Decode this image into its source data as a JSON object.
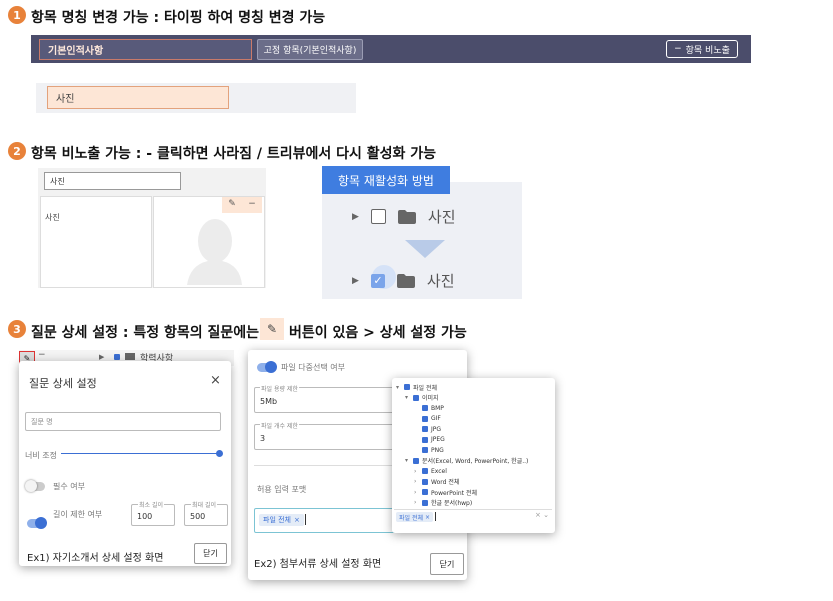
{
  "section1": {
    "badge": "1",
    "heading": "항목 명칭 변경 가능 : 타이핑 하여 명칭 변경 가능",
    "field_value": "기본인적사항",
    "fixed_button": "고정 항목(기본인적사항)",
    "hide_button": "항목 비노출",
    "photo_field": "사진"
  },
  "section2": {
    "badge": "2",
    "heading": "항목 비노출 가능 : - 클릭하면 사라짐 / 트리뷰에서 다시 활성화 가능",
    "search_value": "사진",
    "list_item": "사진",
    "edit_icon": "✎",
    "minus_icon": "−",
    "reactivate_title": "항목 재활성화 방법",
    "tree_item_before": "사진",
    "tree_item_after": "사진"
  },
  "section3": {
    "badge": "3",
    "heading_a": "질문 상세 설정 : 특정 항목의 질문에는",
    "heading_b": "버튼이 있음 > 상세 설정 가능",
    "pencil_icon": "✎",
    "dialog1": {
      "tree_label": "학력사항",
      "title": "질문 상세 설정",
      "close": "×",
      "question_placeholder": "질문 명",
      "width_label": "너비 조정",
      "required_label": "필수 여부",
      "length_label": "길이 제한 여부",
      "min_label": "최소 길이",
      "min_value": "100",
      "max_label": "최대 길이",
      "max_value": "500",
      "caption": "Ex1) 자기소개서 상세 설정 화면",
      "close_button": "닫기"
    },
    "dialog2": {
      "multi_label": "파일 다중선택 여부",
      "capacity_label": "파일 용량 제한",
      "capacity_value": "5Mb",
      "count_label": "파일 개수 제한",
      "count_value": "3",
      "format_label": "허용 입력 포맷",
      "tag": "파일 전체",
      "caption": "Ex2) 첨부서류 상세 설정 화면",
      "close_button": "닫기"
    },
    "format_tree": {
      "items": [
        {
          "label": "파일 전체",
          "level": 0,
          "arrow": "▾"
        },
        {
          "label": "이미지",
          "level": 1,
          "arrow": "▾"
        },
        {
          "label": "BMP",
          "level": 2,
          "arrow": ""
        },
        {
          "label": "GIF",
          "level": 2,
          "arrow": ""
        },
        {
          "label": "JPG",
          "level": 2,
          "arrow": ""
        },
        {
          "label": "JPEG",
          "level": 2,
          "arrow": ""
        },
        {
          "label": "PNG",
          "level": 2,
          "arrow": ""
        },
        {
          "label": "문서(Excel, Word, PowerPoint, 한글..)",
          "level": 1,
          "arrow": "▾"
        },
        {
          "label": "Excel",
          "level": 2,
          "arrow": "›"
        },
        {
          "label": "Word 전체",
          "level": 2,
          "arrow": "›"
        },
        {
          "label": "PowerPoint 전체",
          "level": 2,
          "arrow": "›"
        },
        {
          "label": "한글 문서(hwp)",
          "level": 2,
          "arrow": "›"
        }
      ],
      "tag": "파일 전체"
    }
  },
  "colors": {
    "accent_orange": "#e8823a",
    "header_bar": "#4b4d6b",
    "blue": "#3b6fd4"
  }
}
